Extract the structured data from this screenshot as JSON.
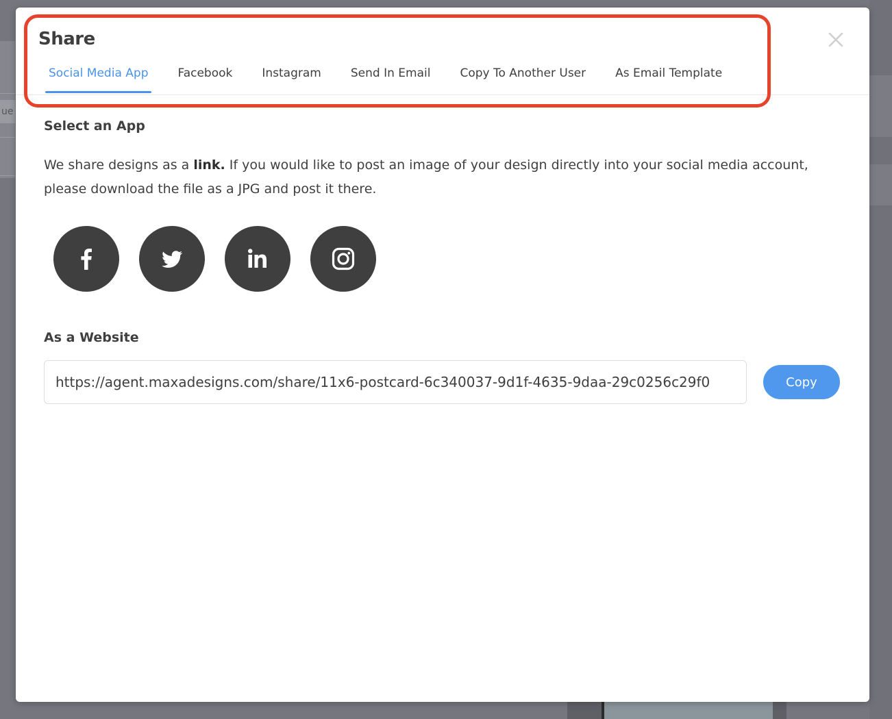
{
  "background": {
    "fragment_text": "ue"
  },
  "modal": {
    "title": "Share",
    "tabs": [
      {
        "label": "Social Media App",
        "active": true
      },
      {
        "label": "Facebook",
        "active": false
      },
      {
        "label": "Instagram",
        "active": false
      },
      {
        "label": "Send In Email",
        "active": false
      },
      {
        "label": "Copy To Another User",
        "active": false
      },
      {
        "label": "As Email Template",
        "active": false
      }
    ],
    "close_icon": "close-icon",
    "annotation_color": "#e5432b"
  },
  "select_app": {
    "title": "Select an App",
    "desc_prefix": "We share designs as a ",
    "desc_bold": "link.",
    "desc_suffix": " If you would like to post an image of your design directly into your social media account, please download the file as a JPG and post it there.",
    "apps": [
      {
        "name": "facebook",
        "icon": "facebook-icon"
      },
      {
        "name": "twitter",
        "icon": "twitter-icon"
      },
      {
        "name": "linkedin",
        "icon": "linkedin-icon"
      },
      {
        "name": "instagram",
        "icon": "instagram-icon"
      }
    ]
  },
  "website": {
    "title": "As a Website",
    "url": "https://agent.maxadesigns.com/share/11x6-postcard-6c340037-9d1f-4635-9daa-29c0256c29f0",
    "copy_label": "Copy"
  },
  "colors": {
    "accent": "#4a93e8",
    "copy_button": "#4f98ee",
    "icon_circle": "#3f3f3f",
    "text": "#3f3f3f"
  }
}
